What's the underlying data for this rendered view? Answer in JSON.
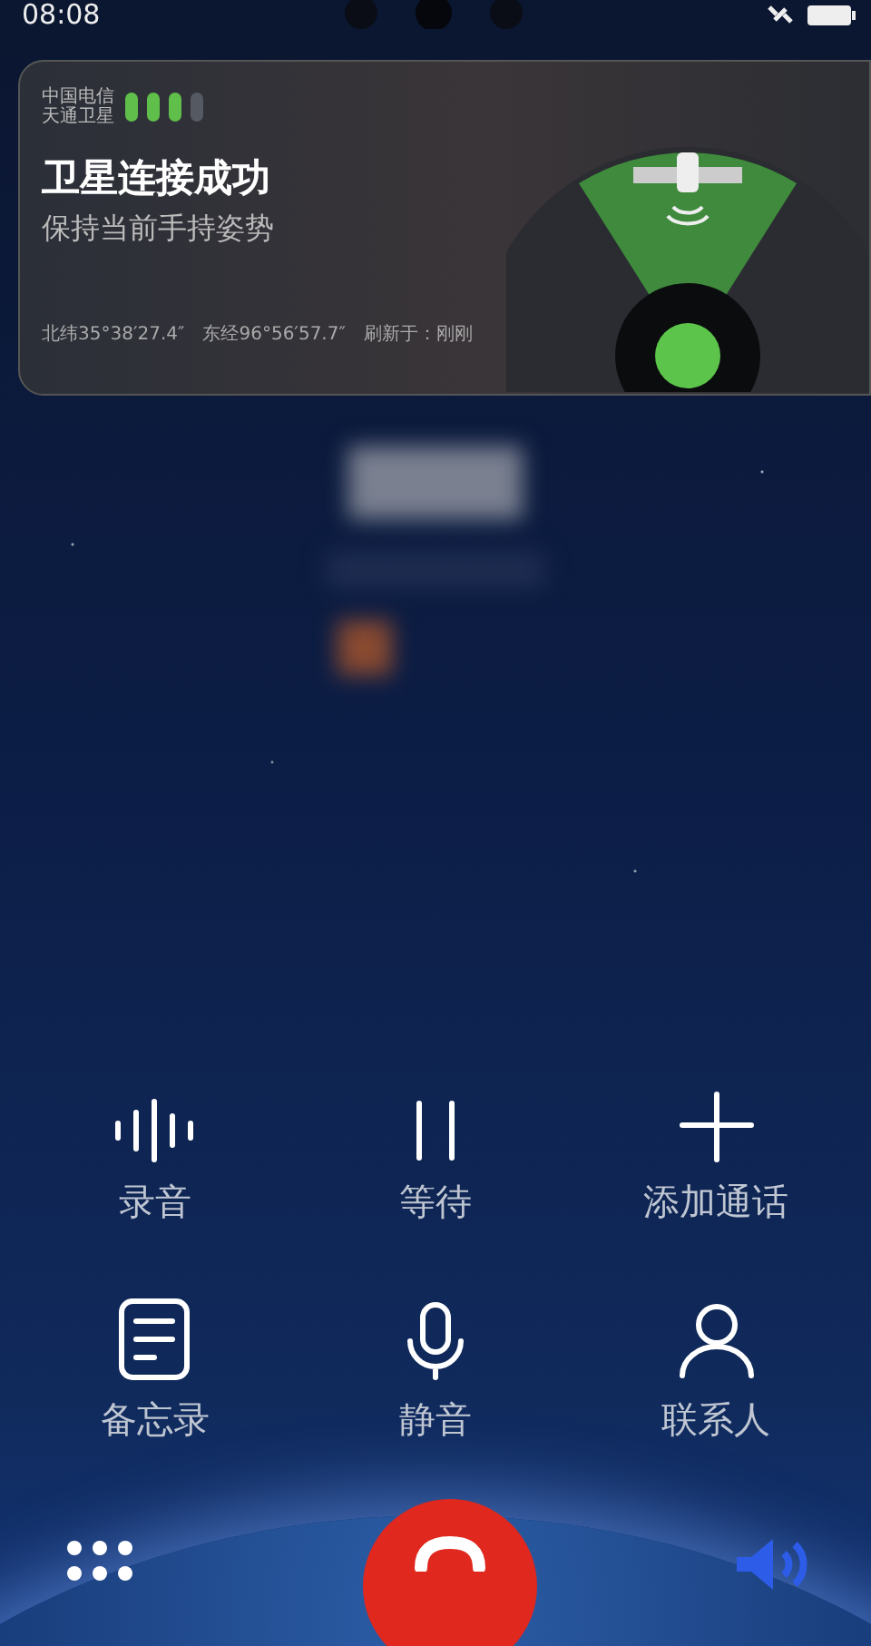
{
  "status_bar": {
    "time": "08:08"
  },
  "satellite_card": {
    "carrier_lines": [
      "中国电信",
      "天通卫星"
    ],
    "title": "卫星连接成功",
    "subtitle": "保持当前手持姿势",
    "latitude": "北纬35°38′27.4″",
    "longitude": "东经96°56′57.7″",
    "refresh": "刷新于：刚刚"
  },
  "actions": [
    {
      "kind": "record",
      "label": "录音"
    },
    {
      "kind": "hold",
      "label": "等待"
    },
    {
      "kind": "add",
      "label": "添加通话"
    },
    {
      "kind": "memo",
      "label": "备忘录"
    },
    {
      "kind": "mute",
      "label": "静音"
    },
    {
      "kind": "contacts",
      "label": "联系人"
    }
  ],
  "bottom_bar": {
    "speaker_on": true
  }
}
